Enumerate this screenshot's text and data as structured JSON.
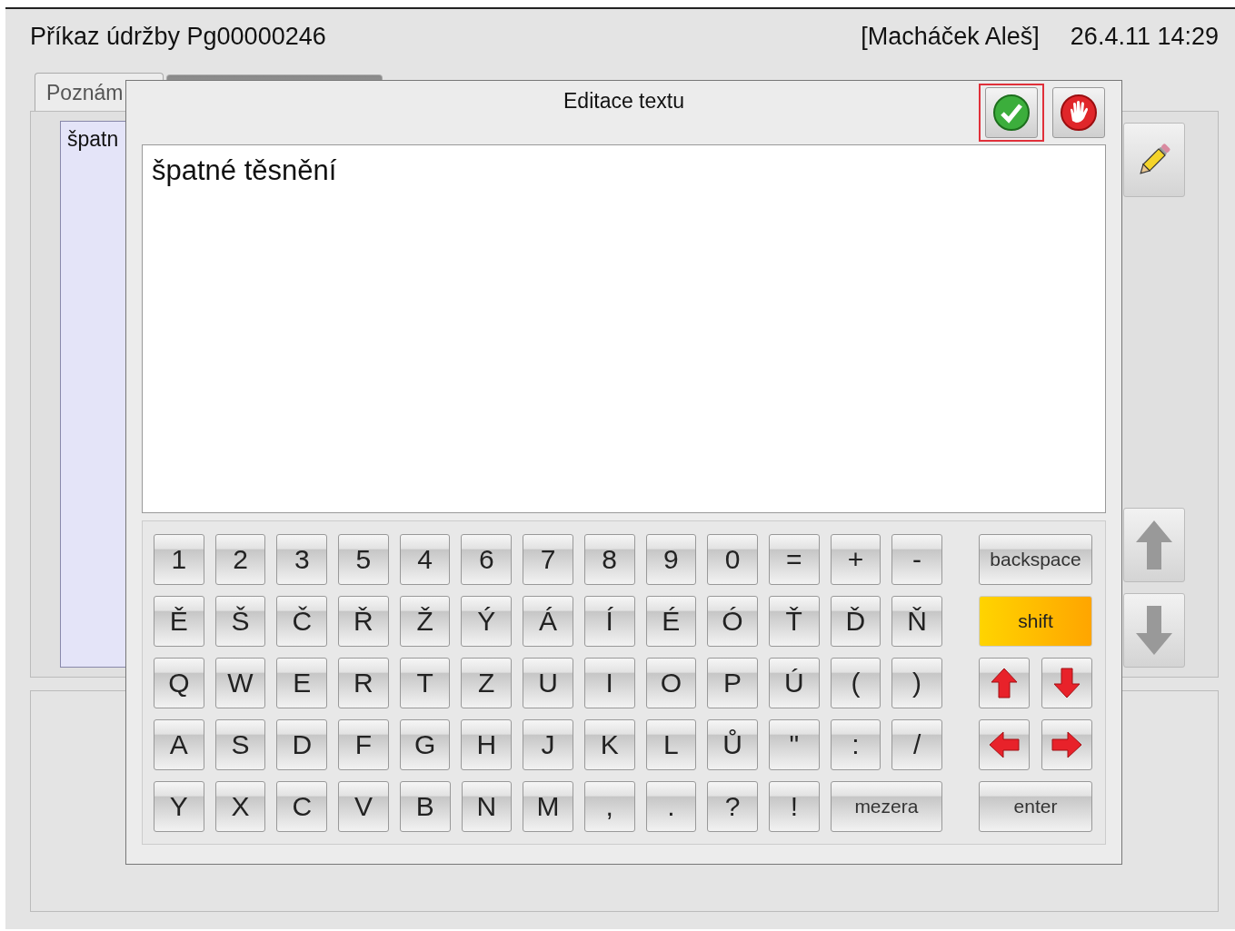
{
  "header": {
    "title": "Příkaz údržby Pg00000246",
    "user": "[Macháček Aleš]",
    "datetime": "26.4.11 14:29"
  },
  "tabs": [
    {
      "label": "Poznám",
      "selected": true
    },
    {
      "selected": false
    }
  ],
  "notes_list": {
    "text": "špatn"
  },
  "dialog": {
    "title": "Editace textu",
    "buttons": [
      {
        "kind": "confirm",
        "focused": true
      },
      {
        "kind": "cancel",
        "focused": false
      }
    ],
    "text_value": "špatné těsnění",
    "keyboard": [
      {
        "keys": [
          {
            "label": "1"
          },
          {
            "label": "2"
          },
          {
            "label": "3"
          },
          {
            "label": "5"
          },
          {
            "label": "4"
          },
          {
            "label": "6"
          },
          {
            "label": "7"
          },
          {
            "label": "8"
          },
          {
            "label": "9"
          },
          {
            "label": "0"
          },
          {
            "label": "="
          },
          {
            "label": "+"
          },
          {
            "label": "-"
          }
        ],
        "side": [
          {
            "kind": "action",
            "label": "backspace",
            "active": false
          }
        ]
      },
      {
        "keys": [
          {
            "label": "Ě"
          },
          {
            "label": "Š"
          },
          {
            "label": "Č"
          },
          {
            "label": "Ř"
          },
          {
            "label": "Ž"
          },
          {
            "label": "Ý"
          },
          {
            "label": "Á"
          },
          {
            "label": "Í"
          },
          {
            "label": "É"
          },
          {
            "label": "Ó"
          },
          {
            "label": "Ť"
          },
          {
            "label": "Ď"
          },
          {
            "label": "Ň"
          }
        ],
        "side": [
          {
            "kind": "action",
            "label": "shift",
            "active": true
          }
        ]
      },
      {
        "keys": [
          {
            "label": "Q"
          },
          {
            "label": "W"
          },
          {
            "label": "E"
          },
          {
            "label": "R"
          },
          {
            "label": "T"
          },
          {
            "label": "Z"
          },
          {
            "label": "U"
          },
          {
            "label": "I"
          },
          {
            "label": "O"
          },
          {
            "label": "P"
          },
          {
            "label": "Ú"
          },
          {
            "label": "("
          },
          {
            "label": ")"
          }
        ],
        "side": [
          {
            "kind": "uparrow"
          },
          {
            "kind": "downarrow"
          }
        ]
      },
      {
        "keys": [
          {
            "label": "A"
          },
          {
            "label": "S"
          },
          {
            "label": "D"
          },
          {
            "label": "F"
          },
          {
            "label": "G"
          },
          {
            "label": "H"
          },
          {
            "label": "J"
          },
          {
            "label": "K"
          },
          {
            "label": "L"
          },
          {
            "label": "Ů"
          },
          {
            "label": "\""
          },
          {
            "label": ":"
          },
          {
            "label": "/"
          }
        ],
        "side": [
          {
            "kind": "leftarrow"
          },
          {
            "kind": "rightarrow"
          }
        ]
      },
      {
        "keys": [
          {
            "label": "Y"
          },
          {
            "label": "X"
          },
          {
            "label": "C"
          },
          {
            "label": "V"
          },
          {
            "label": "B"
          },
          {
            "label": "N"
          },
          {
            "label": "M"
          },
          {
            "label": ","
          },
          {
            "label": "."
          },
          {
            "label": "?"
          },
          {
            "label": "!"
          },
          {
            "label": "mezera",
            "kind": "space"
          }
        ],
        "side": [
          {
            "kind": "action",
            "label": "enter",
            "active": false
          }
        ]
      }
    ]
  }
}
